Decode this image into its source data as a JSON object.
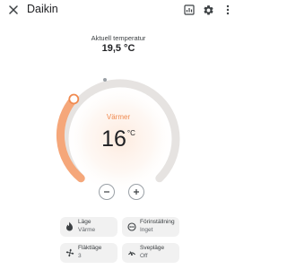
{
  "header": {
    "title": "Daikin",
    "icons": [
      "close-icon",
      "history-icon",
      "gear-icon",
      "more-vert-icon"
    ]
  },
  "current": {
    "label": "Aktuell temperatur",
    "value": "19,5 °C"
  },
  "dial": {
    "mode": "Värmer",
    "target": "16",
    "unit": "°C",
    "arc_color": "#f5a77a",
    "track_color": "#e6e3e1",
    "accent": "#f08a50"
  },
  "controls": {
    "minus_icon": "minus-icon",
    "plus_icon": "plus-icon"
  },
  "tiles": [
    {
      "label": "Läge",
      "value": "Värme",
      "icon": "flame-icon"
    },
    {
      "label": "Förinställning",
      "value": "Inget",
      "icon": "circle-dots-icon"
    },
    {
      "label": "Fläktläge",
      "value": "3",
      "icon": "fan-icon"
    },
    {
      "label": "Svepläge",
      "value": "Off",
      "icon": "swing-icon"
    }
  ]
}
